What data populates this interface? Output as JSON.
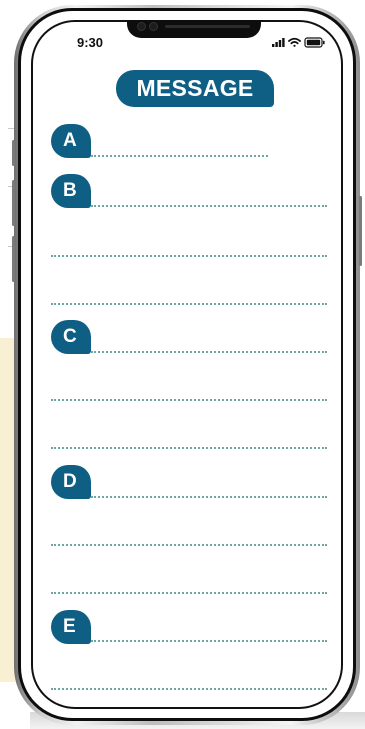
{
  "status_bar": {
    "time": "9:30"
  },
  "title": "MESSAGE",
  "sections": [
    {
      "letter": "A",
      "line_count": 1
    },
    {
      "letter": "B",
      "line_count": 3
    },
    {
      "letter": "C",
      "line_count": 3
    },
    {
      "letter": "D",
      "line_count": 3
    },
    {
      "letter": "E",
      "line_count": 2
    }
  ],
  "colors": {
    "accent": "#0f5f84",
    "dotted_line": "#6ea7a0",
    "page_background_left": "#f9efd2"
  },
  "icons": [
    "signal-icon",
    "wifi-icon",
    "battery-icon",
    "front-camera-icon",
    "speaker-grille-icon"
  ]
}
